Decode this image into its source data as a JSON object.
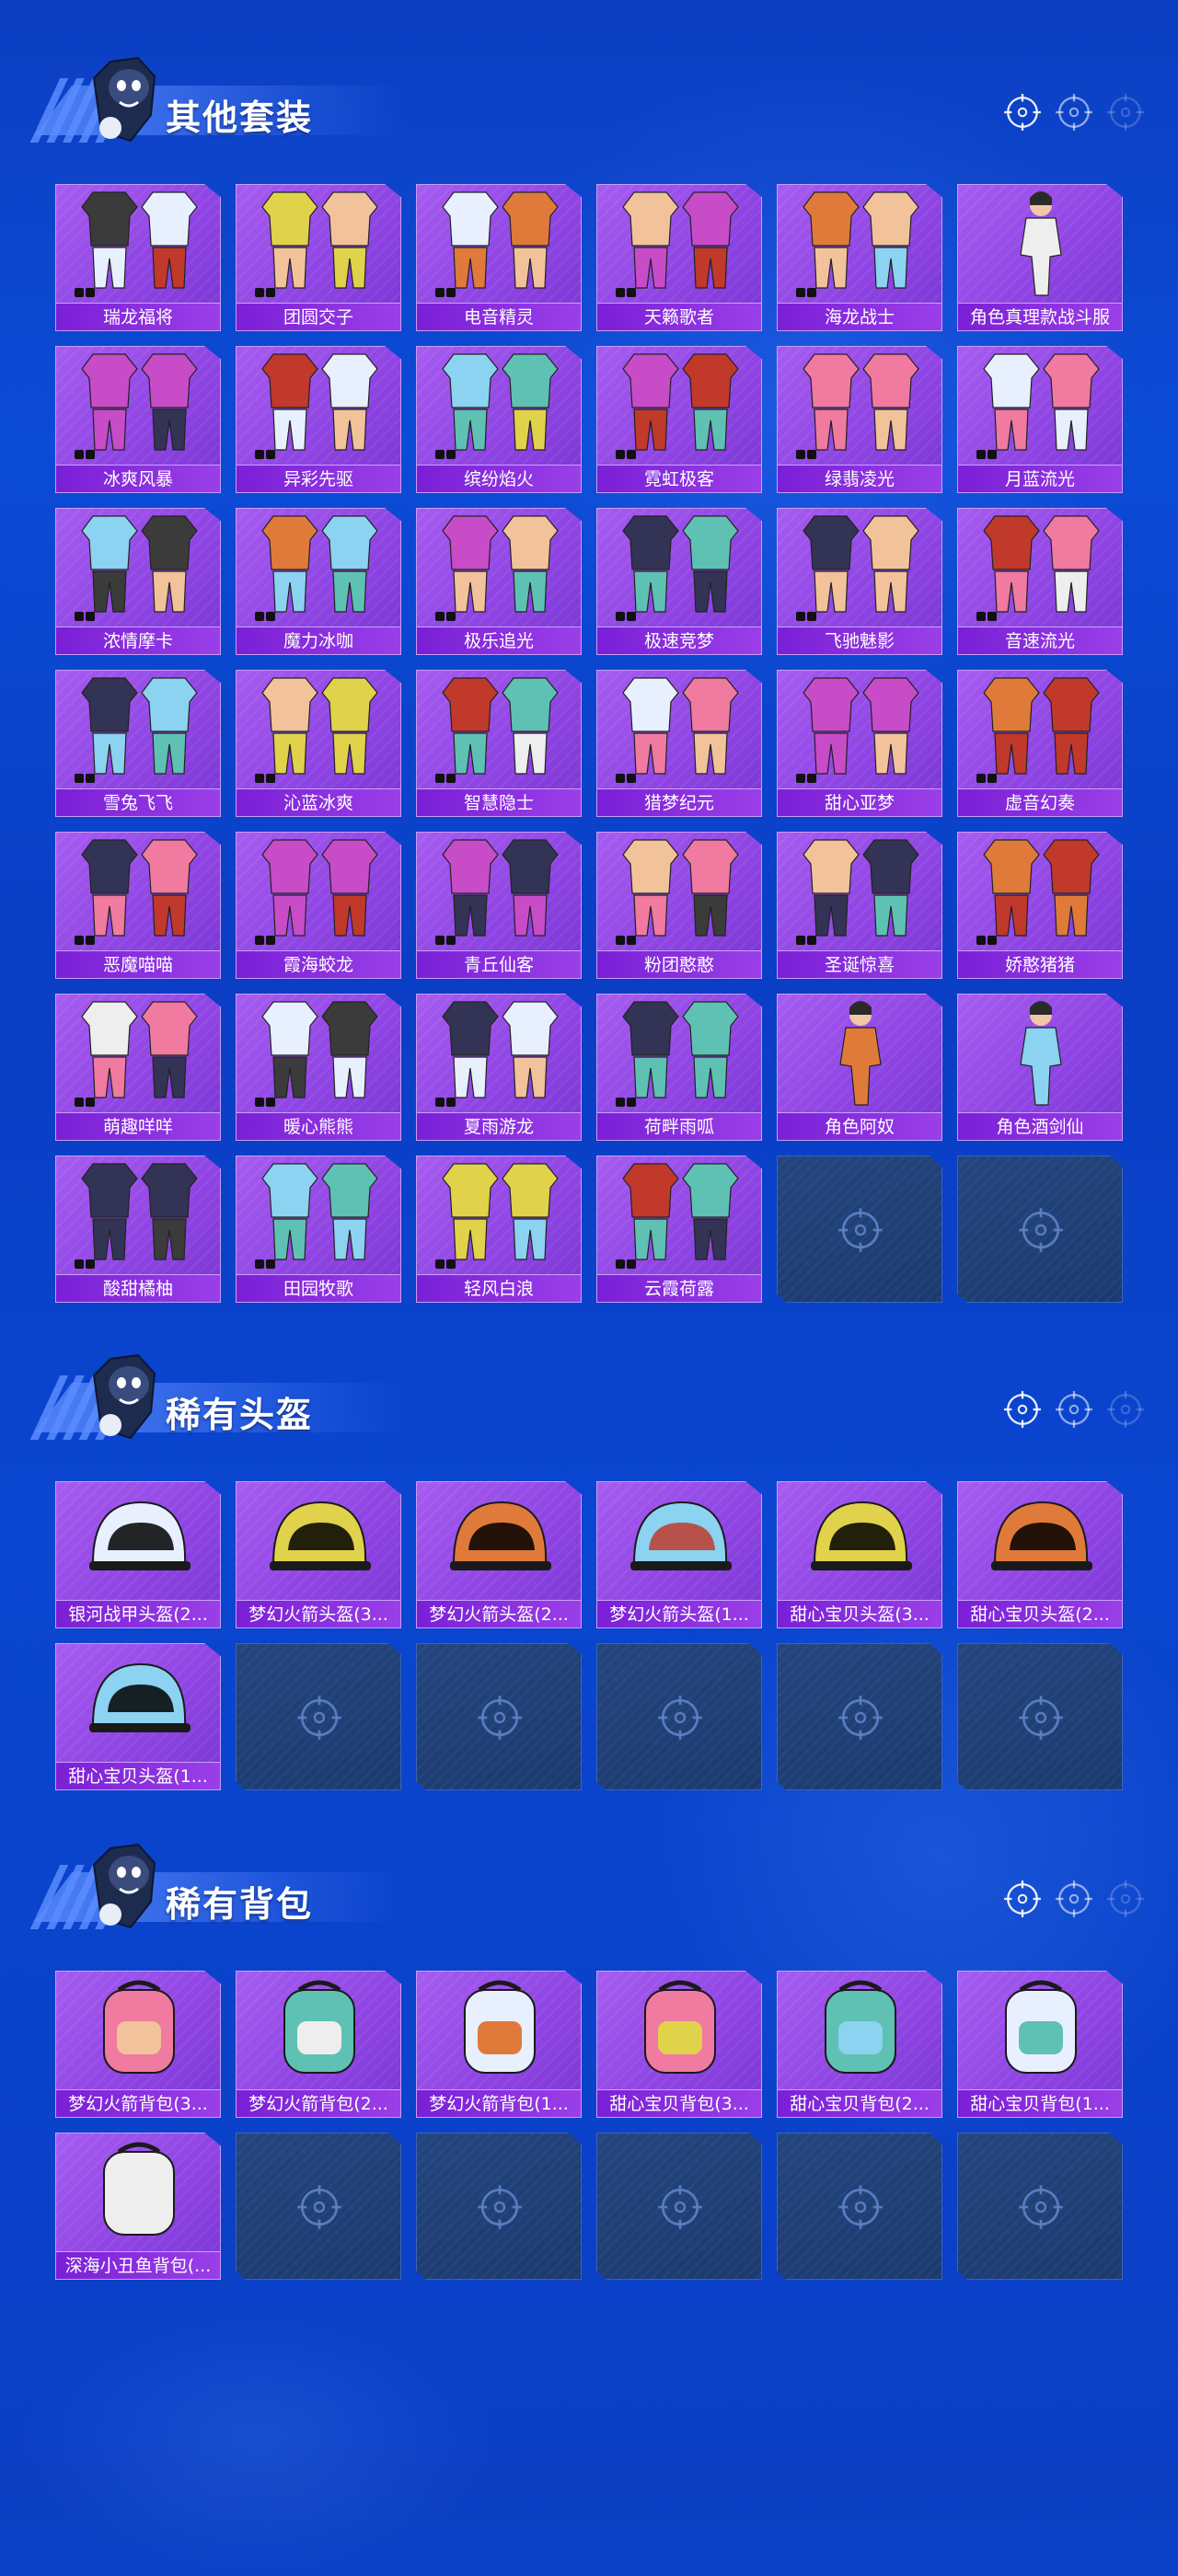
{
  "theme": {
    "card_colors": [
      "#c0392b",
      "#e07a3a",
      "#3b3b3b",
      "#eeeeee",
      "#5fc1b4",
      "#f2c29b",
      "#8bd3f0",
      "#c84cc8",
      "#e0d24a",
      "#e8f0ff",
      "#333355",
      "#f07aa0"
    ],
    "empty_slot_color": "#1f3f78",
    "card_color": "#9a4fe8",
    "label_color": "#8a2fe0"
  },
  "sections": [
    {
      "title": "其他套装",
      "header_icons": [
        "target-icon",
        "target-icon",
        "target-icon"
      ],
      "items": [
        {
          "label": "瑞龙福将",
          "art": "outfit"
        },
        {
          "label": "团圆交子",
          "art": "outfit"
        },
        {
          "label": "电音精灵",
          "art": "outfit"
        },
        {
          "label": "天籁歌者",
          "art": "outfit"
        },
        {
          "label": "海龙战士",
          "art": "outfit"
        },
        {
          "label": "角色真理款战斗服",
          "art": "character"
        },
        {
          "label": "冰爽风暴",
          "art": "outfit"
        },
        {
          "label": "异彩先驱",
          "art": "outfit"
        },
        {
          "label": "缤纷焰火",
          "art": "outfit"
        },
        {
          "label": "霓虹极客",
          "art": "outfit"
        },
        {
          "label": "绿翡凌光",
          "art": "outfit"
        },
        {
          "label": "月蓝流光",
          "art": "outfit"
        },
        {
          "label": "浓情摩卡",
          "art": "outfit"
        },
        {
          "label": "魔力冰咖",
          "art": "outfit"
        },
        {
          "label": "极乐追光",
          "art": "outfit"
        },
        {
          "label": "极速竞梦",
          "art": "outfit"
        },
        {
          "label": "飞驰魅影",
          "art": "outfit"
        },
        {
          "label": "音速流光",
          "art": "outfit"
        },
        {
          "label": "雪兔飞飞",
          "art": "outfit"
        },
        {
          "label": "沁蓝冰爽",
          "art": "outfit"
        },
        {
          "label": "智慧隐士",
          "art": "outfit"
        },
        {
          "label": "猎梦纪元",
          "art": "outfit"
        },
        {
          "label": "甜心亚梦",
          "art": "outfit"
        },
        {
          "label": "虚音幻奏",
          "art": "outfit"
        },
        {
          "label": "恶魔喵喵",
          "art": "outfit"
        },
        {
          "label": "霞海蛟龙",
          "art": "outfit"
        },
        {
          "label": "青丘仙客",
          "art": "outfit"
        },
        {
          "label": "粉团憨憨",
          "art": "outfit"
        },
        {
          "label": "圣诞惊喜",
          "art": "outfit"
        },
        {
          "label": "娇憨猪猪",
          "art": "outfit"
        },
        {
          "label": "萌趣咩咩",
          "art": "outfit"
        },
        {
          "label": "暖心熊熊",
          "art": "outfit"
        },
        {
          "label": "夏雨游龙",
          "art": "outfit"
        },
        {
          "label": "荷畔雨呱",
          "art": "outfit"
        },
        {
          "label": "角色阿奴",
          "art": "character"
        },
        {
          "label": "角色酒剑仙",
          "art": "character"
        },
        {
          "label": "酸甜橘柚",
          "art": "outfit"
        },
        {
          "label": "田园牧歌",
          "art": "outfit"
        },
        {
          "label": "轻风白浪",
          "art": "outfit"
        },
        {
          "label": "云霞荷露",
          "art": "outfit"
        }
      ],
      "empty_slots": 2
    },
    {
      "title": "稀有头盔",
      "header_icons": [
        "target-icon",
        "target-icon",
        "target-icon"
      ],
      "items": [
        {
          "label": "银河战甲头盔(2...",
          "art": "helmet"
        },
        {
          "label": "梦幻火箭头盔(3...",
          "art": "helmet"
        },
        {
          "label": "梦幻火箭头盔(2...",
          "art": "helmet"
        },
        {
          "label": "梦幻火箭头盔(1...",
          "art": "helmet"
        },
        {
          "label": "甜心宝贝头盔(3...",
          "art": "helmet"
        },
        {
          "label": "甜心宝贝头盔(2...",
          "art": "helmet"
        },
        {
          "label": "甜心宝贝头盔(1...",
          "art": "helmet"
        }
      ],
      "empty_slots": 5
    },
    {
      "title": "稀有背包",
      "header_icons": [
        "target-icon",
        "target-icon",
        "target-icon"
      ],
      "items": [
        {
          "label": "梦幻火箭背包(3...",
          "art": "backpack"
        },
        {
          "label": "梦幻火箭背包(2...",
          "art": "backpack"
        },
        {
          "label": "梦幻火箭背包(1...",
          "art": "backpack"
        },
        {
          "label": "甜心宝贝背包(3...",
          "art": "backpack"
        },
        {
          "label": "甜心宝贝背包(2...",
          "art": "backpack"
        },
        {
          "label": "甜心宝贝背包(1...",
          "art": "backpack"
        },
        {
          "label": "深海小丑鱼背包(...",
          "art": "backpack"
        }
      ],
      "empty_slots": 5
    }
  ]
}
